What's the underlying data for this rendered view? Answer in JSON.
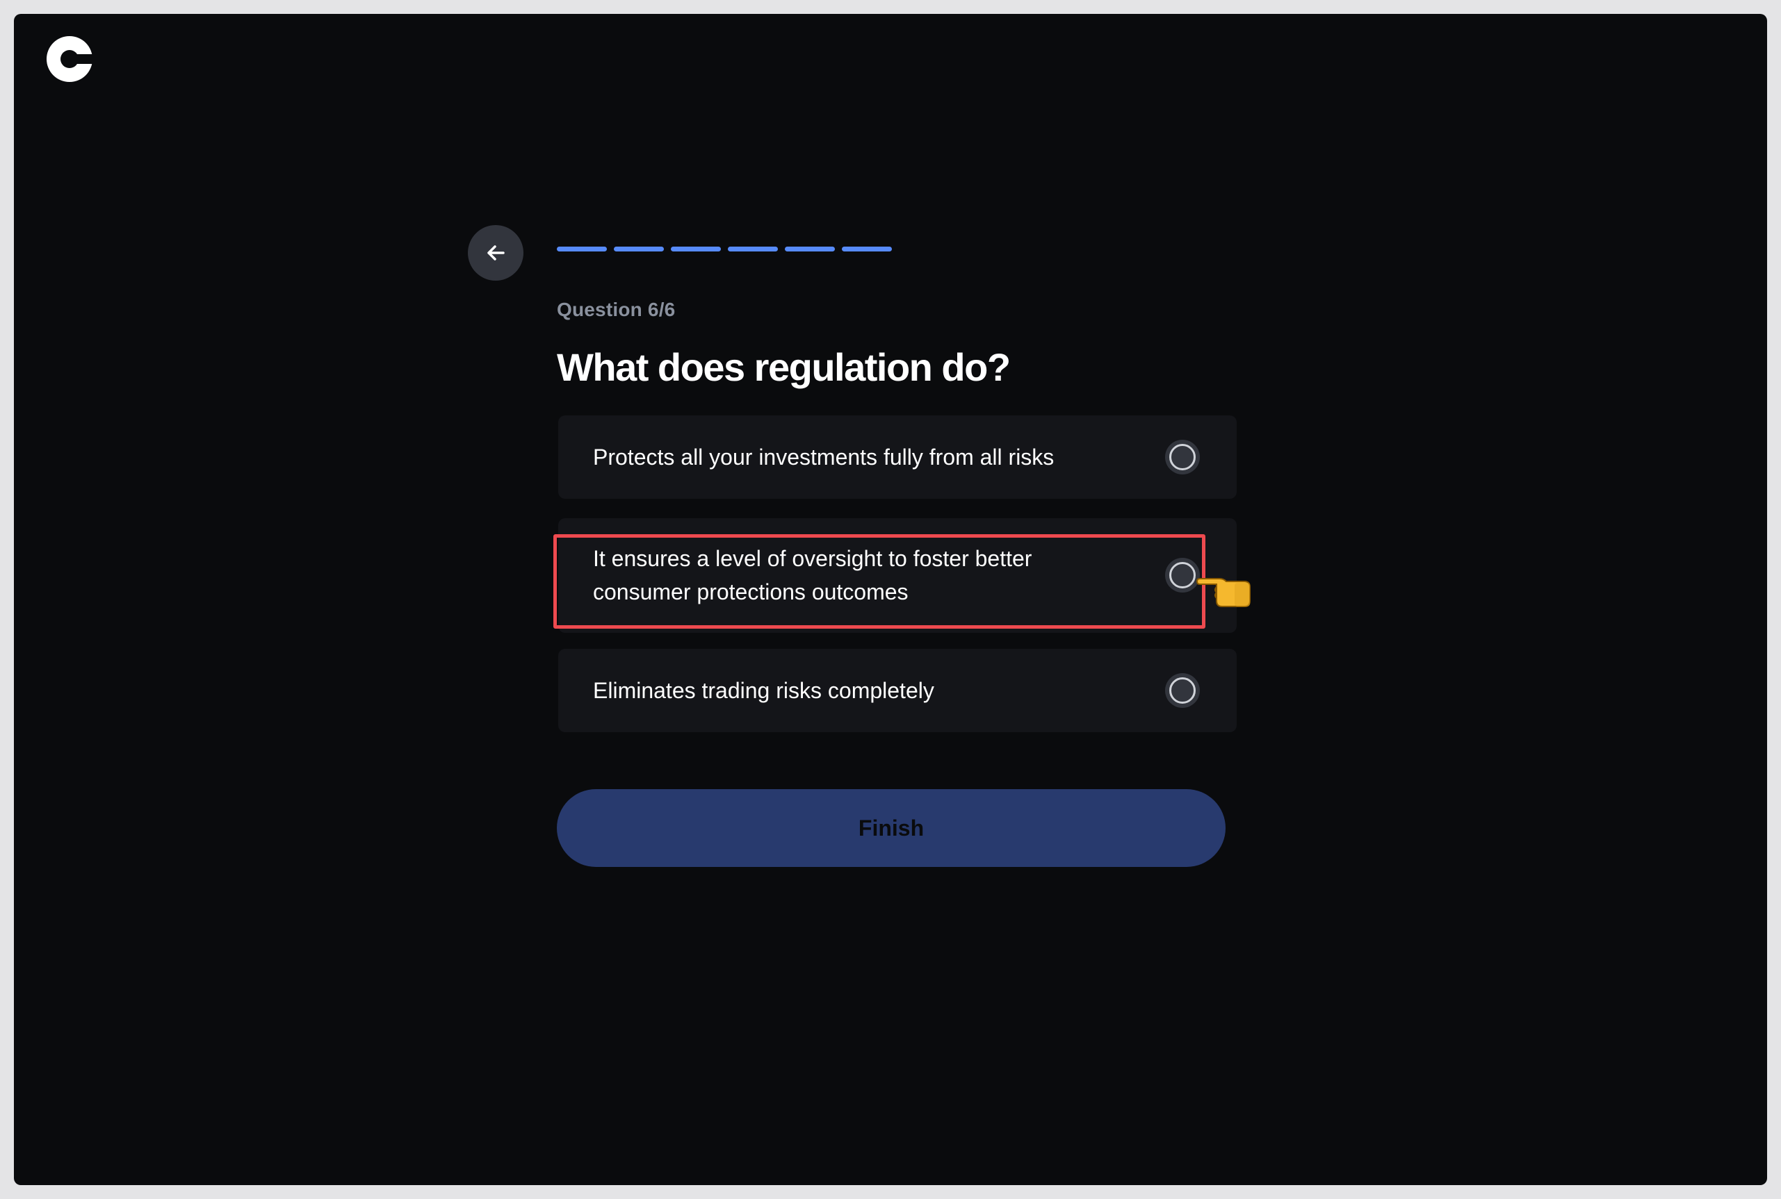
{
  "app": {
    "logo_icon": "coinbase-c-logo-icon"
  },
  "header": {
    "back_icon": "arrow-left-icon",
    "progress": {
      "current": 6,
      "total": 6,
      "color": "#578bfa"
    }
  },
  "question": {
    "counter": "Question 6/6",
    "title": "What does regulation do?"
  },
  "options": [
    {
      "label": "Protects all your investments fully from all risks",
      "selected": false
    },
    {
      "label": "It ensures a level of oversight to foster better consumer protections outcomes",
      "selected": false,
      "highlighted": true
    },
    {
      "label": "Eliminates trading risks completely",
      "selected": false
    }
  ],
  "annotation": {
    "highlight_color": "#ee4a4f",
    "pointer_icon": "pointing-hand-icon"
  },
  "actions": {
    "finish_label": "Finish",
    "finish_enabled": false
  },
  "colors": {
    "background": "#0a0b0d",
    "card": "#141519",
    "accent": "#578bfa",
    "button_disabled": "#283a6e"
  }
}
